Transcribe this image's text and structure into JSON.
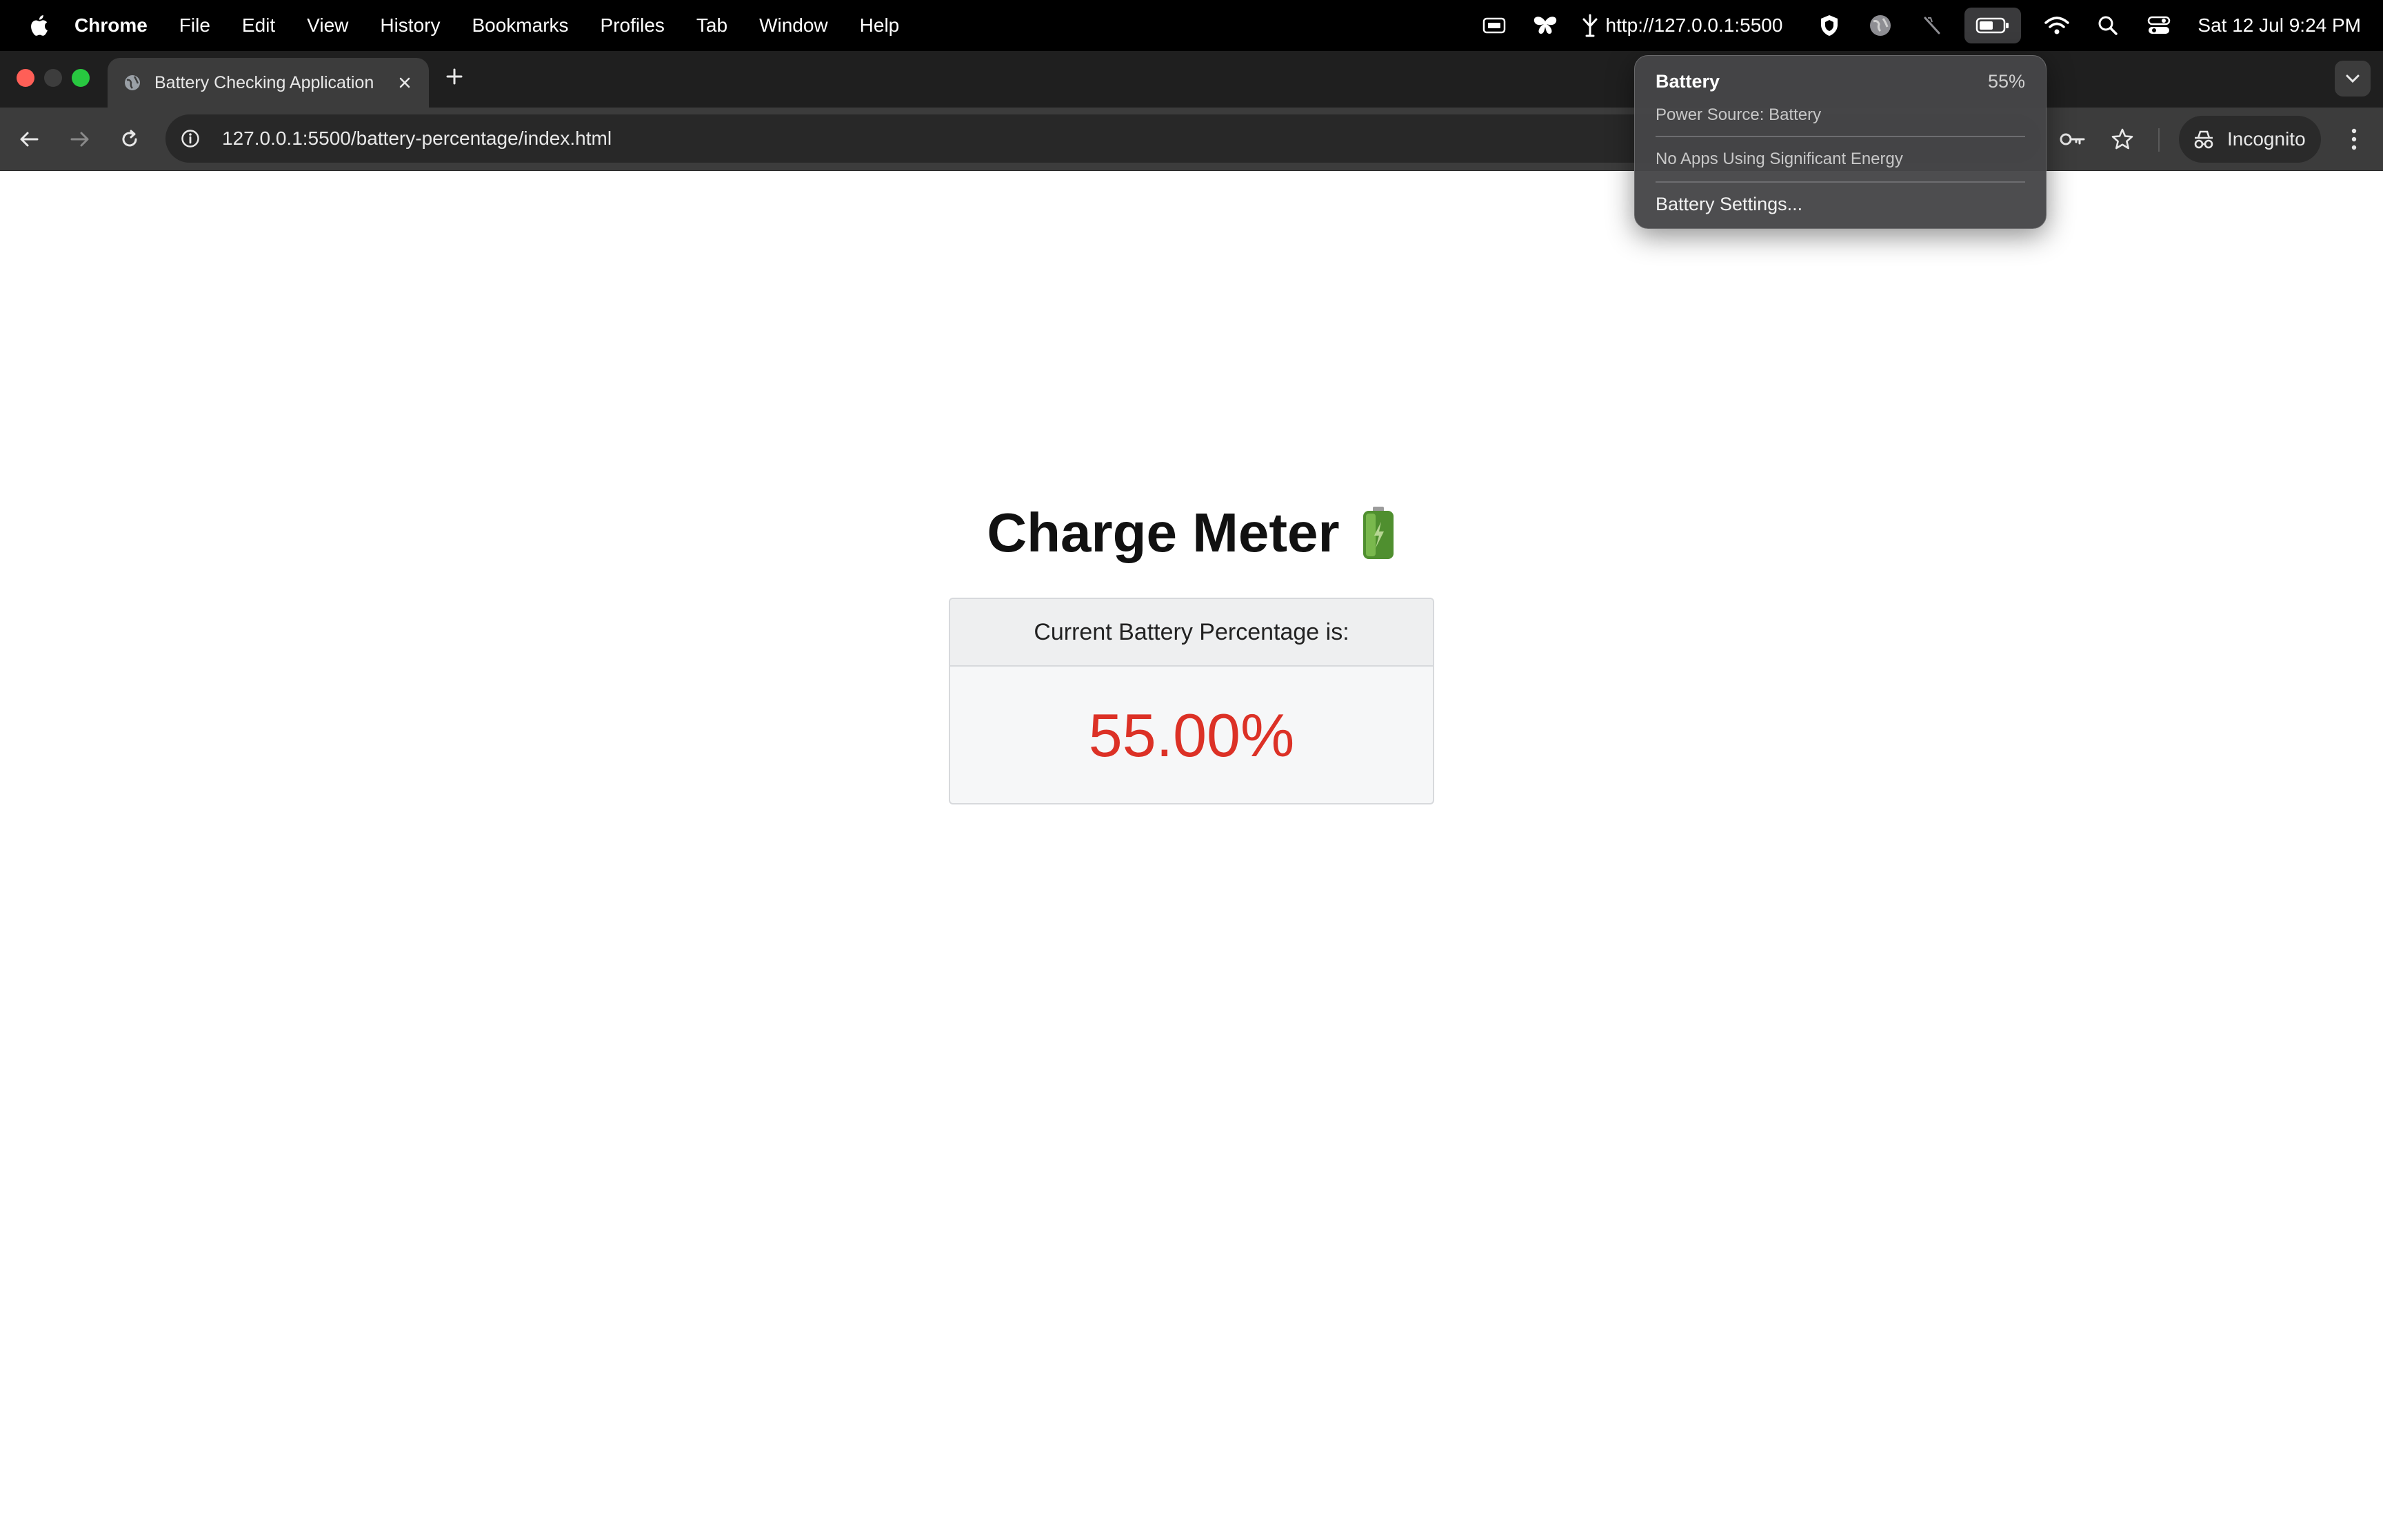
{
  "menubar": {
    "app_name": "Chrome",
    "menus": [
      "File",
      "Edit",
      "View",
      "History",
      "Bookmarks",
      "Profiles",
      "Tab",
      "Window",
      "Help"
    ],
    "url_status": "http://127.0.0.1:5500",
    "clock": "Sat 12 Jul  9:24 PM"
  },
  "browser": {
    "tab_title": "Battery Checking Application",
    "url": "127.0.0.1:5500/battery-percentage/index.html",
    "incognito_label": "Incognito"
  },
  "page": {
    "title": "Charge Meter",
    "card_header": "Current Battery Percentage is:",
    "battery_value": "55.00%"
  },
  "battery_menu": {
    "title": "Battery",
    "percent": "55%",
    "power_source": "Power Source: Battery",
    "apps_status": "No Apps Using Significant Energy",
    "settings_label": "Battery Settings..."
  },
  "colors": {
    "value_color": "#dc3126",
    "menubar_bg": "#000000",
    "toolbar_bg": "#3c3c3c"
  },
  "icons": {
    "battery_fill_percent": 55
  }
}
